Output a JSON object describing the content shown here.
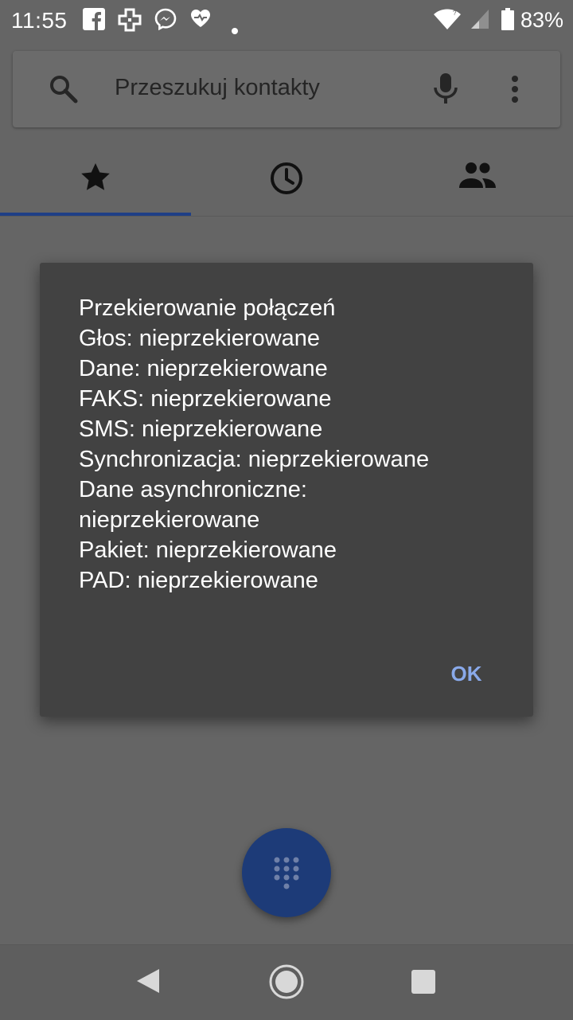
{
  "status_bar": {
    "time": "11:55",
    "battery": "83%",
    "icons": [
      "facebook-icon",
      "medical-cross-icon",
      "messenger-icon",
      "heart-pulse-icon",
      "notification-dot-icon",
      "wifi-icon",
      "signal-icon",
      "battery-icon"
    ]
  },
  "search": {
    "placeholder": "Przeszukuj kontakty",
    "icons": [
      "search-icon",
      "mic-icon",
      "more-vert-icon"
    ]
  },
  "tabs": [
    {
      "icon": "star-icon",
      "selected": true
    },
    {
      "icon": "clock-icon",
      "selected": false
    },
    {
      "icon": "people-icon",
      "selected": false
    }
  ],
  "dialog": {
    "lines": [
      "Przekierowanie połączeń",
      "Głos: nieprzekierowane",
      "Dane: nieprzekierowane",
      "FAKS: nieprzekierowane",
      "SMS: nieprzekierowane",
      "Synchronizacja: nieprzekierowane",
      "Dane asynchroniczne:",
      "nieprzekierowane",
      "Pakiet: nieprzekierowane",
      "PAD: nieprzekierowane"
    ],
    "ok_label": "OK"
  },
  "colors": {
    "accent": "#1f3f86",
    "fab": "#1d3b78",
    "ok_text": "#89a9ea",
    "dialog_bg": "#424242"
  }
}
